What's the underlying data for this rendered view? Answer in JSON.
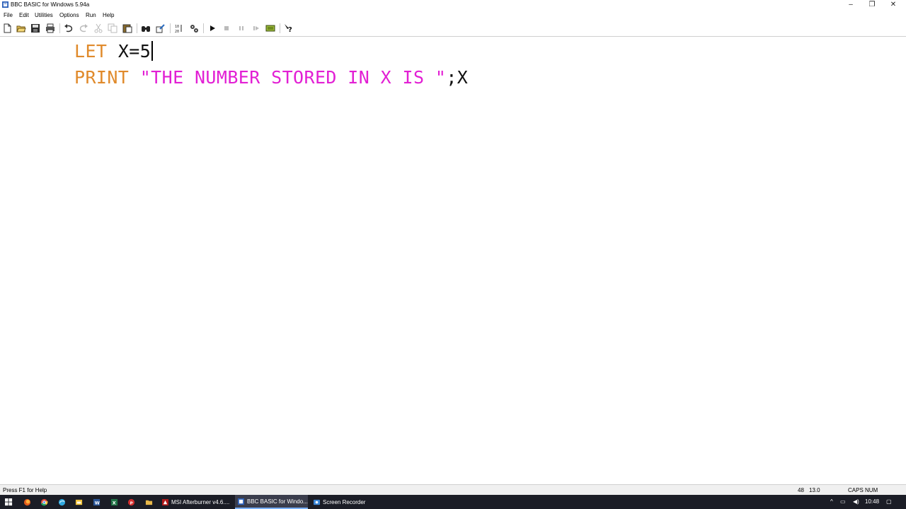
{
  "window": {
    "title": "BBC BASIC for Windows 5.94a",
    "controls": [
      "–",
      "❐",
      "✕"
    ]
  },
  "menu": [
    "File",
    "Edit",
    "Utilities",
    "Options",
    "Run",
    "Help"
  ],
  "toolbar": {
    "buttons": [
      "new-icon",
      "open-icon",
      "save-icon",
      "print-icon",
      "undo-icon",
      "redo-icon",
      "cut-icon",
      "copy-icon",
      "paste-icon",
      "find-icon",
      "replace-icon",
      "renumber-icon",
      "compile-icon",
      "run-icon",
      "stop-icon",
      "pause-icon",
      "step-icon",
      "immediate-icon",
      "help-icon"
    ]
  },
  "code": {
    "line1": {
      "keyword": "LET",
      "rest": "X=5"
    },
    "line2": {
      "keyword": "PRINT",
      "string": "\"THE NUMBER STORED IN X IS \"",
      "rest": ";X"
    }
  },
  "status": {
    "help": "Press F1 for Help",
    "position": "48",
    "size": "13.0",
    "caps": "CAPS",
    "num": "NUM"
  },
  "taskbar": {
    "apps": [
      {
        "label": "MSI Afterburner v4.6....",
        "active": false
      },
      {
        "label": "BBC BASIC for Windo...",
        "active": true
      },
      {
        "label": "Screen Recorder",
        "active": false
      }
    ],
    "time": "10:48"
  },
  "colors": {
    "keyword": "#e08a2b",
    "string": "#e21fd4",
    "taskbar": "#1b1d26"
  }
}
